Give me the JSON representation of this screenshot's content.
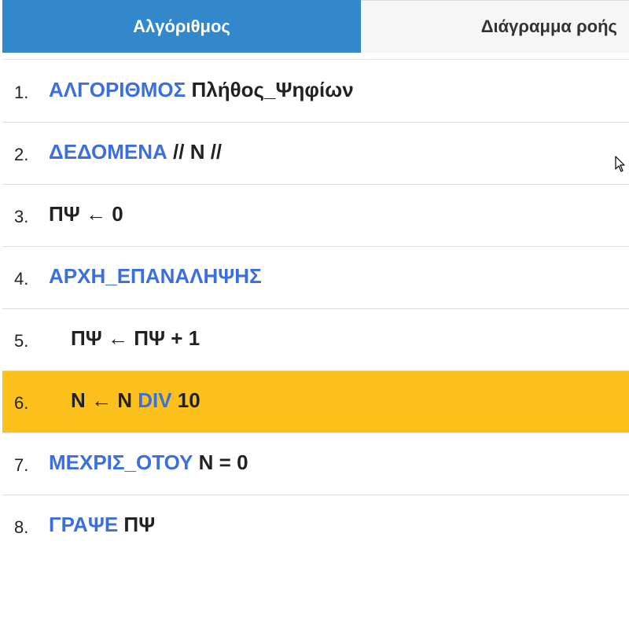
{
  "tabs": {
    "algorithm": "Αλγόριθμος",
    "flowchart": "Διάγραμμα ροής"
  },
  "colors": {
    "active_tab": "#3388cc",
    "keyword": "#3b6fe0",
    "highlight": "#fdc11e"
  },
  "lines": [
    {
      "num": "1.",
      "kw": "ΑΛΓΟΡΙΘΜΟΣ",
      "rest": " Πλήθος_Ψηφίων"
    },
    {
      "num": "2.",
      "kw": "ΔΕΔΟΜΕΝΑ",
      "rest": " // Ν //"
    },
    {
      "num": "3.",
      "text": "ΠΨ ← 0"
    },
    {
      "num": "4.",
      "kw": "ΑΡΧΗ_ΕΠΑΝΑΛΗΨΗΣ"
    },
    {
      "num": "5.",
      "text": "ΠΨ ← ΠΨ + 1"
    },
    {
      "num": "6.",
      "pre": "Ν ← Ν ",
      "kw": "DIV",
      "post": " 10"
    },
    {
      "num": "7.",
      "kw": "ΜΕΧΡΙΣ_ΟΤΟΥ",
      "rest": " Ν = 0"
    },
    {
      "num": "8.",
      "kw": "ΓΡΑΨΕ",
      "rest": " ΠΨ"
    }
  ]
}
